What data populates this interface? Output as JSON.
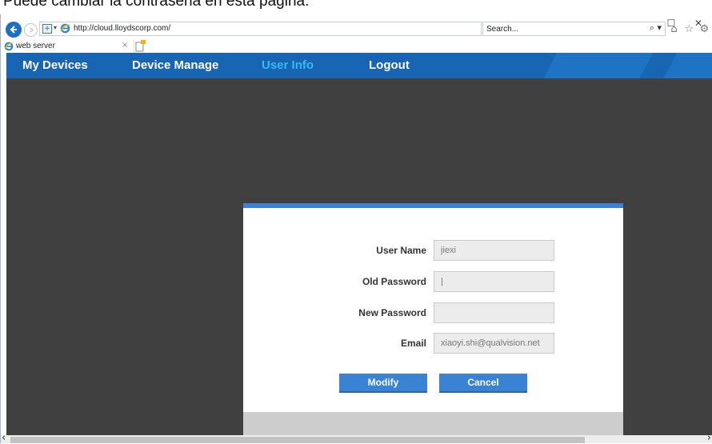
{
  "caption": {
    "text": "Puede cambiar la contraseña en esta página."
  },
  "window": {
    "minimize": "–",
    "maximize": "☐",
    "close": "✕"
  },
  "address_bar": {
    "url": "http://cloud.lloydscorp.com/",
    "refresh": "▾ C",
    "search_placeholder": "Search..."
  },
  "tab": {
    "title": "web server",
    "close": "×"
  },
  "nav": {
    "items": [
      {
        "label": "My Devices"
      },
      {
        "label": "Device Manage"
      },
      {
        "label": "User Info"
      },
      {
        "label": "Logout"
      }
    ],
    "active": "User Info"
  },
  "form": {
    "user_name_label": "User Name",
    "user_name_value": "jiexi",
    "old_password_label": "Old Password",
    "old_password_value": "|",
    "new_password_label": "New Password",
    "new_password_value": "",
    "email_label": "Email",
    "email_value": "xiaoyi.shi@qualvision.net",
    "modify_label": "Modify",
    "cancel_label": "Cancel"
  },
  "icons": {
    "back": "back-arrow-icon",
    "forward": "forward-arrow-icon",
    "search": "search-icon",
    "home": "home-icon",
    "favorites": "star-icon",
    "settings": "gear-icon",
    "feedback": "smiley-icon"
  },
  "colors": {
    "nav_bg": "#1865b3",
    "nav_active": "#39b8f4",
    "content_bg": "#404040",
    "dialog_accent": "#3b82d6",
    "button_bg": "#3a82d4"
  }
}
